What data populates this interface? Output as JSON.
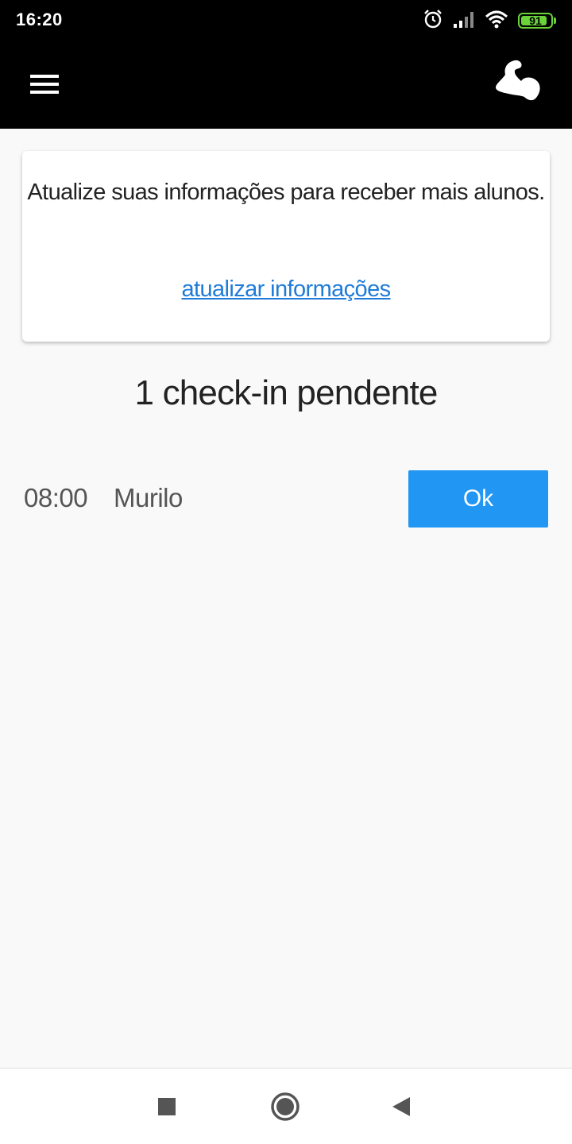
{
  "status_bar": {
    "time": "16:20",
    "battery_level": "91",
    "battery_fraction": 0.91,
    "icons": [
      "alarm-icon",
      "signal-icon",
      "wifi-icon",
      "battery-icon"
    ]
  },
  "app_bar": {
    "menu_icon": "hamburger-menu-icon",
    "logo_icon": "flexed-arm-logo-icon"
  },
  "update_card": {
    "message": "Atualize suas informações para receber mais alunos.",
    "link_label": "atualizar informações"
  },
  "pending": {
    "count": "1",
    "label": "check-in pendente"
  },
  "checkins": [
    {
      "time": "08:00",
      "name": "Murilo",
      "action_label": "Ok"
    }
  ],
  "nav_bar": {
    "icons": [
      "recents-square-icon",
      "home-circle-icon",
      "back-triangle-icon"
    ]
  },
  "colors": {
    "app_bar": "#000000",
    "background": "#f9f9f9",
    "accent": "#2196f3",
    "link": "#1e7bd8",
    "battery": "#6ad33a"
  }
}
